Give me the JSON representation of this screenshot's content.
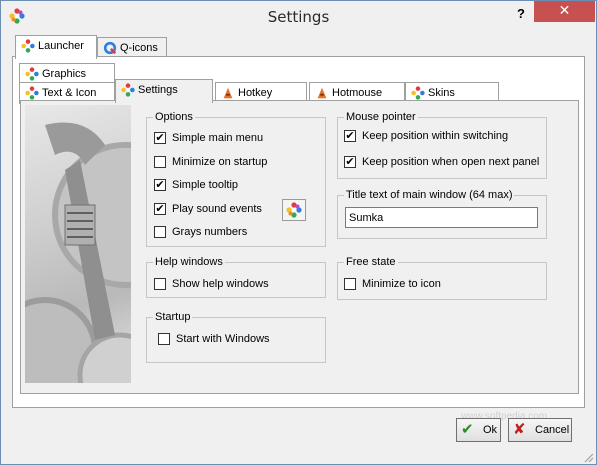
{
  "window": {
    "title": "Settings",
    "help_label": "?",
    "close_label": "✕"
  },
  "top_tabs": [
    {
      "label": "Launcher",
      "icon": "flower-icon",
      "active": true
    },
    {
      "label": "Q-icons",
      "icon": "q-icon",
      "active": false
    }
  ],
  "sub_tabs_row1": [
    {
      "label": "Graphics",
      "icon": "flower-icon"
    }
  ],
  "sub_tabs_row2": [
    {
      "label": "Text & Icon",
      "icon": "flower-icon",
      "active": false
    },
    {
      "label": "Settings",
      "icon": "flower-icon",
      "active": true
    },
    {
      "label": "Hotkey",
      "icon": "hotkey-icon",
      "active": false
    },
    {
      "label": "Hotmouse",
      "icon": "hotmouse-icon",
      "active": false
    },
    {
      "label": "Skins",
      "icon": "flower-icon",
      "active": false
    }
  ],
  "options": {
    "legend": "Options",
    "items": [
      {
        "label": "Simple main menu",
        "checked": true
      },
      {
        "label": "Minimize on startup",
        "checked": false
      },
      {
        "label": "Simple tooltip",
        "checked": true
      },
      {
        "label": "Play sound events",
        "checked": true
      },
      {
        "label": "Grays numbers",
        "checked": false
      }
    ]
  },
  "help_windows": {
    "legend": "Help windows",
    "items": [
      {
        "label": "Show help windows",
        "checked": false
      }
    ]
  },
  "startup": {
    "legend": "Startup",
    "items": [
      {
        "label": "Start with Windows",
        "checked": false
      }
    ]
  },
  "mouse_pointer": {
    "legend": "Mouse pointer",
    "items": [
      {
        "label": "Keep position within switching",
        "checked": true
      },
      {
        "label": "Keep position when open next panel",
        "checked": true
      }
    ]
  },
  "title_text": {
    "legend": "Title text of main window (64 max)",
    "value": "Sumka"
  },
  "free_state": {
    "legend": "Free state",
    "items": [
      {
        "label": "Minimize to icon",
        "checked": false
      }
    ]
  },
  "buttons": {
    "ok_label": "Ok",
    "cancel_label": "Cancel"
  },
  "watermark": "www.softpedia.com",
  "colors": {
    "close_bg": "#c75050",
    "ok_check": "#2a8a2a",
    "cancel_x": "#c02020"
  }
}
